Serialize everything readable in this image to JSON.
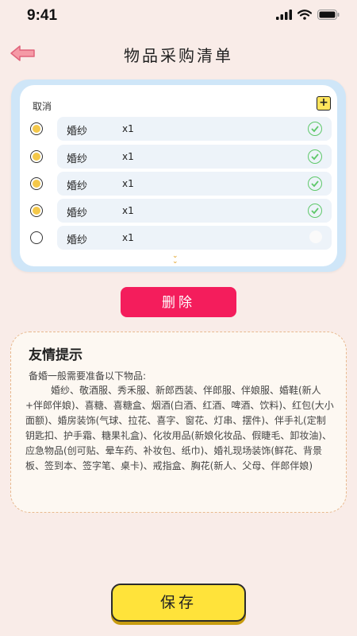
{
  "status_bar": {
    "time": "9:41"
  },
  "header": {
    "title": "物品采购清单"
  },
  "list": {
    "cancel_label": "取消",
    "add_label": "+",
    "items": [
      {
        "name": "婚纱",
        "qty": "x1",
        "selected": true,
        "checked": true
      },
      {
        "name": "婚纱",
        "qty": "x1",
        "selected": true,
        "checked": true
      },
      {
        "name": "婚纱",
        "qty": "x1",
        "selected": true,
        "checked": true
      },
      {
        "name": "婚纱",
        "qty": "x1",
        "selected": true,
        "checked": true
      },
      {
        "name": "婚纱",
        "qty": "x1",
        "selected": false,
        "checked": false
      }
    ]
  },
  "delete_label": "删除",
  "tip": {
    "title": "友情提示",
    "intro": "备婚一般需要准备以下物品:",
    "body": "婚纱、敬酒服、秀禾服、新郎西装、伴郎服、伴娘服、婚鞋(新人+伴郎伴娘)、喜糖、喜糖盒、烟酒(白酒、红酒、啤酒、饮料)、红包(大小面额)、婚房装饰(气球、拉花、喜字、窗花、灯串、摆件)、伴手礼(定制钥匙扣、护手霜、糖果礼盒)、化妆用品(新娘化妆品、假睫毛、卸妆油)、应急物品(创可贴、晕车药、补妆包、纸巾)、婚礼现场装饰(鲜花、背景板、签到本、签字笔、桌卡)、戒指盒、胸花(新人、父母、伴郎伴娘)"
  },
  "save_label": "保存",
  "colors": {
    "accent_red": "#f41d5c",
    "accent_yellow": "#ffe33a",
    "check_green": "#5fc86a",
    "card_blue": "#cfe6f8"
  }
}
